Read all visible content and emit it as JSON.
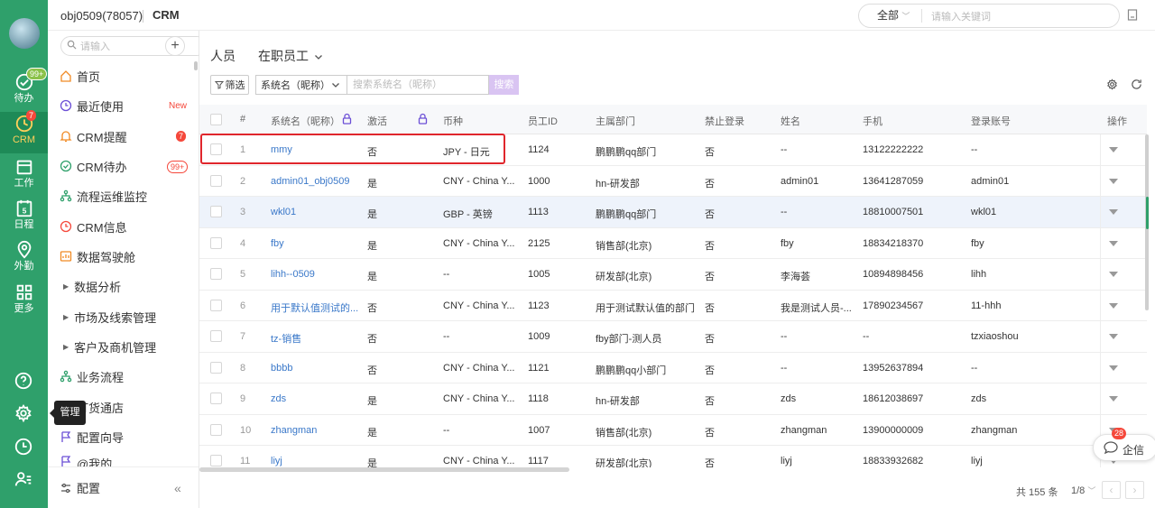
{
  "header": {
    "org": "obj0509(78057)",
    "app": "CRM",
    "scope": "全部",
    "search_placeholder": "请输入关键词"
  },
  "rail": {
    "items": [
      {
        "label": "待办",
        "badge": "99+"
      },
      {
        "label": "CRM",
        "badge": "7"
      },
      {
        "label": "工作"
      },
      {
        "label": "日程",
        "date": "5"
      },
      {
        "label": "外勤"
      },
      {
        "label": "更多"
      }
    ],
    "tooltip": "管理"
  },
  "nav": {
    "search_placeholder": "请输入",
    "items": [
      "首页",
      "最近使用",
      "CRM提醒",
      "CRM待办",
      "流程运维监控",
      "CRM信息",
      "数据驾驶舱",
      "数据分析",
      "市场及线索管理",
      "客户及商机管理",
      "业务流程",
      "订货通店",
      "配置向导",
      "@我的"
    ],
    "new_tag": "New",
    "reminder_badge": "7",
    "todo_badge": "99+",
    "footer": "配置"
  },
  "page": {
    "title": "人员",
    "view": "在职员工",
    "filter": "筛选",
    "field_select": "系统名（昵称）",
    "search_placeholder": "搜索系统名（昵称）",
    "search_btn": "搜索"
  },
  "table": {
    "headers": [
      "#",
      "系统名（昵称）",
      "激活",
      "币种",
      "员工ID",
      "主属部门",
      "禁止登录",
      "姓名",
      "手机",
      "登录账号",
      "操作"
    ],
    "rows": [
      [
        "1",
        "mmy",
        "否",
        "JPY - 日元",
        "1124",
        "鹏鹏鹏qq部门",
        "否",
        "--",
        "13122222222",
        "--"
      ],
      [
        "2",
        "admin01_obj0509",
        "是",
        "CNY - China Y...",
        "1000",
        "hn-研发部",
        "否",
        "admin01",
        "13641287059",
        "admin01"
      ],
      [
        "3",
        "wkl01",
        "是",
        "GBP - 英镑",
        "1113",
        "鹏鹏鹏qq部门",
        "否",
        "--",
        "18810007501",
        "wkl01"
      ],
      [
        "4",
        "fby",
        "是",
        "CNY - China Y...",
        "2125",
        "销售部(北京)",
        "否",
        "fby",
        "18834218370",
        "fby"
      ],
      [
        "5",
        "lihh--0509",
        "是",
        "--",
        "1005",
        "研发部(北京)",
        "否",
        "李海荟",
        "10894898456",
        "lihh"
      ],
      [
        "6",
        "用于默认值测试的...",
        "否",
        "CNY - China Y...",
        "1123",
        "用于测试默认值的部门",
        "否",
        "我是测试人员-...",
        "17890234567",
        "11-hhh"
      ],
      [
        "7",
        "tz-销售",
        "否",
        "--",
        "1009",
        "fby部门-测人员",
        "否",
        "--",
        "--",
        "tzxiaoshou"
      ],
      [
        "8",
        "bbbb",
        "否",
        "CNY - China Y...",
        "1121",
        "鹏鹏鹏qq小部门",
        "否",
        "--",
        "13952637894",
        "--"
      ],
      [
        "9",
        "zds",
        "是",
        "CNY - China Y...",
        "1118",
        "hn-研发部",
        "否",
        "zds",
        "18612038697",
        "zds"
      ],
      [
        "10",
        "zhangman",
        "是",
        "--",
        "1007",
        "销售部(北京)",
        "否",
        "zhangman",
        "13900000009",
        "zhangman"
      ],
      [
        "11",
        "liyj",
        "是",
        "CNY - China Y...",
        "1117",
        "研发部(北京)",
        "否",
        "liyj",
        "18833932682",
        "liyj"
      ]
    ]
  },
  "footer": {
    "total": "共 155 条",
    "page": "1/8"
  },
  "qixin": {
    "label": "企信",
    "badge": "28"
  }
}
